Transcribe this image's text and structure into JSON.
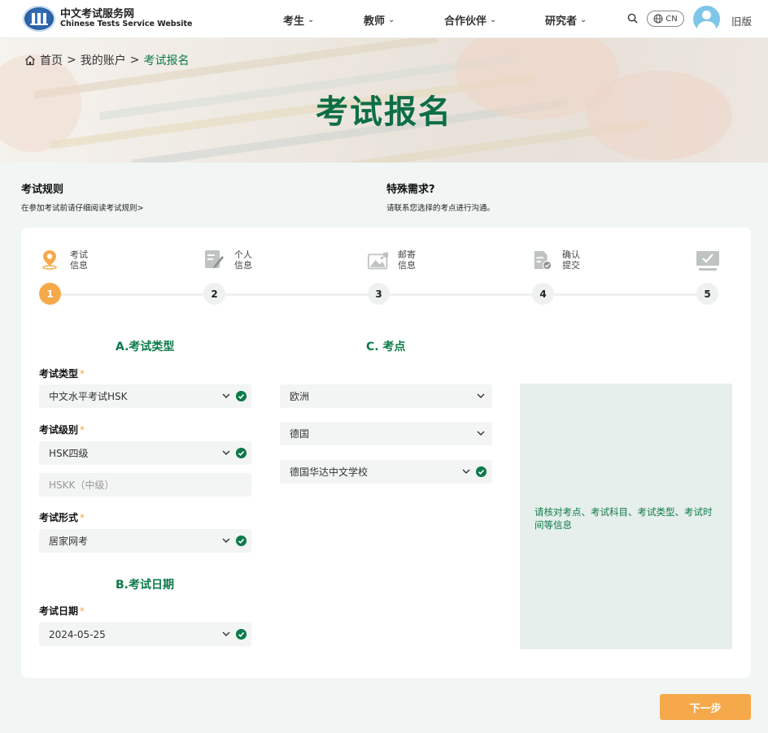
{
  "header": {
    "logo_cn": "中文考试服务网",
    "logo_en": "Chinese Tests Service Website",
    "nav": [
      {
        "label": "考生"
      },
      {
        "label": "教师"
      },
      {
        "label": "合作伙伴"
      },
      {
        "label": "研究者"
      }
    ],
    "lang": "CN",
    "old_version": "旧版"
  },
  "breadcrumb": {
    "home": "首页",
    "account": "我的账户",
    "current": "考试报名",
    "separator": ">"
  },
  "banner": {
    "title": "考试报名"
  },
  "info": {
    "rules_title": "考试规则",
    "rules_sub": "在参加考试前请仔细阅读考试规则>",
    "special_title": "特殊需求?",
    "special_sub": "请联系您选择的考点进行沟通。"
  },
  "steps": [
    {
      "line1": "考试",
      "line2": "信息",
      "number": "1",
      "icon": "location-pin-icon",
      "active": true
    },
    {
      "line1": "个人",
      "line2": "信息",
      "number": "2",
      "icon": "edit-form-icon",
      "active": false
    },
    {
      "line1": "邮寄",
      "line2": "信息",
      "number": "3",
      "icon": "image-icon",
      "active": false
    },
    {
      "line1": "确认",
      "line2": "提交",
      "number": "4",
      "icon": "document-check-icon",
      "active": false
    },
    {
      "line1": "",
      "line2": "",
      "number": "5",
      "icon": "monitor-check-icon",
      "active": false
    }
  ],
  "form": {
    "section_a": "A.考试类型",
    "section_b": "B.考试日期",
    "section_c": "C. 考点",
    "exam_type_label": "考试类型",
    "exam_type_value": "中文水平考试HSK",
    "exam_level_label": "考试级别",
    "exam_level_value": "HSK四级",
    "hskk_placeholder": "HSKK（中级）",
    "exam_format_label": "考试形式",
    "exam_format_value": "居家网考",
    "exam_date_label": "考试日期",
    "exam_date_value": "2024-05-25",
    "region_value": "欧洲",
    "country_value": "德国",
    "center_value": "德国华达中文学校",
    "required_mark": "*"
  },
  "note": "请核对考点、考试科目、考试类型、考试时间等信息",
  "next_button": "下一步",
  "colors": {
    "brand_green": "#0d7a4a",
    "accent_orange": "#f6a94a",
    "background_tint": "#f1f6f4"
  }
}
